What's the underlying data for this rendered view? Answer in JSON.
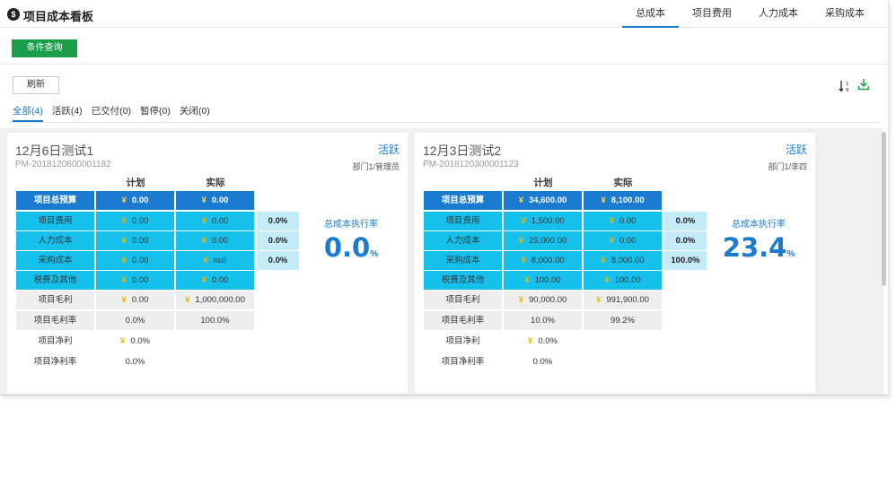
{
  "app": {
    "logo": "$",
    "title": "项目成本看板"
  },
  "nav": {
    "tabs": [
      {
        "label": "总成本",
        "active": true
      },
      {
        "label": "项目费用",
        "active": false
      },
      {
        "label": "人力成本",
        "active": false
      },
      {
        "label": "采购成本",
        "active": false
      }
    ]
  },
  "toolbar": {
    "query_label": "条件查询",
    "refresh_label": "刷新"
  },
  "filters": {
    "tabs": [
      {
        "label": "全部(4)",
        "active": true
      },
      {
        "label": "活跃(4)",
        "active": false
      },
      {
        "label": "已交付(0)",
        "active": false
      },
      {
        "label": "暂停(0)",
        "active": false
      },
      {
        "label": "关闭(0)",
        "active": false
      }
    ]
  },
  "colors": {
    "accent": "#1b7bd1",
    "query_button": "#1a9e4a",
    "budget_row": "#1b7bd1",
    "cost_rows": "#15c0ec",
    "profit_rows": "#eeeeee",
    "rate_cells": "#c4ecf8",
    "yen_sign": "#f0b400"
  },
  "icons": {
    "sort": "sort-icon",
    "download": "download-icon",
    "logo": "logo-icon"
  },
  "cards": [
    {
      "name": "12月6日测试1",
      "code": "PM-2018120600001182",
      "status": "活跃",
      "dept": "部门1/管理员",
      "plan_header": "计划",
      "actual_header": "实际",
      "budget": {
        "label": "项目总预算",
        "plan": "0.00",
        "actual": "0.00"
      },
      "expense": {
        "label": "项目费用",
        "plan": "0.00",
        "actual": "0.00",
        "rate": "0.0%"
      },
      "labor": {
        "label": "人力成本",
        "plan": "0.00",
        "actual": "0.00",
        "rate": "0.0%"
      },
      "purchase": {
        "label": "采购成本",
        "plan": "0.00",
        "actual": "null",
        "rate": "0.0%"
      },
      "tax": {
        "label": "税费及其他",
        "plan": "0.00",
        "actual": "0.00"
      },
      "gross_profit": {
        "label": "项目毛利",
        "plan": "0.00",
        "actual": "1,000,000.00"
      },
      "gross_margin": {
        "label": "项目毛利率",
        "plan": "0.0%",
        "actual": "100.0%"
      },
      "net_profit": {
        "label": "项目净利",
        "plan": "0.0%"
      },
      "net_margin": {
        "label": "项目净利率",
        "plan": "0.0%"
      },
      "exec_label": "总成本执行率",
      "exec_value": "0.0",
      "exec_unit": "%"
    },
    {
      "name": "12月3日测试2",
      "code": "PM-2018120300001123",
      "status": "活跃",
      "dept": "部门1/李四",
      "plan_header": "计划",
      "actual_header": "实际",
      "budget": {
        "label": "项目总预算",
        "plan": "34,600.00",
        "actual": "8,100.00"
      },
      "expense": {
        "label": "项目费用",
        "plan": "1,500.00",
        "actual": "0.00",
        "rate": "0.0%"
      },
      "labor": {
        "label": "人力成本",
        "plan": "25,000.00",
        "actual": "0.00",
        "rate": "0.0%"
      },
      "purchase": {
        "label": "采购成本",
        "plan": "8,000.00",
        "actual": "8,000.00",
        "rate": "100.0%"
      },
      "tax": {
        "label": "税费及其他",
        "plan": "100.00",
        "actual": "100.00"
      },
      "gross_profit": {
        "label": "项目毛利",
        "plan": "90,000.00",
        "actual": "991,900.00"
      },
      "gross_margin": {
        "label": "项目毛利率",
        "plan": "10.0%",
        "actual": "99.2%"
      },
      "net_profit": {
        "label": "项目净利",
        "plan": "0.0%"
      },
      "net_margin": {
        "label": "项目净利率",
        "plan": "0.0%"
      },
      "exec_label": "总成本执行率",
      "exec_value": "23.4",
      "exec_unit": "%"
    }
  ]
}
